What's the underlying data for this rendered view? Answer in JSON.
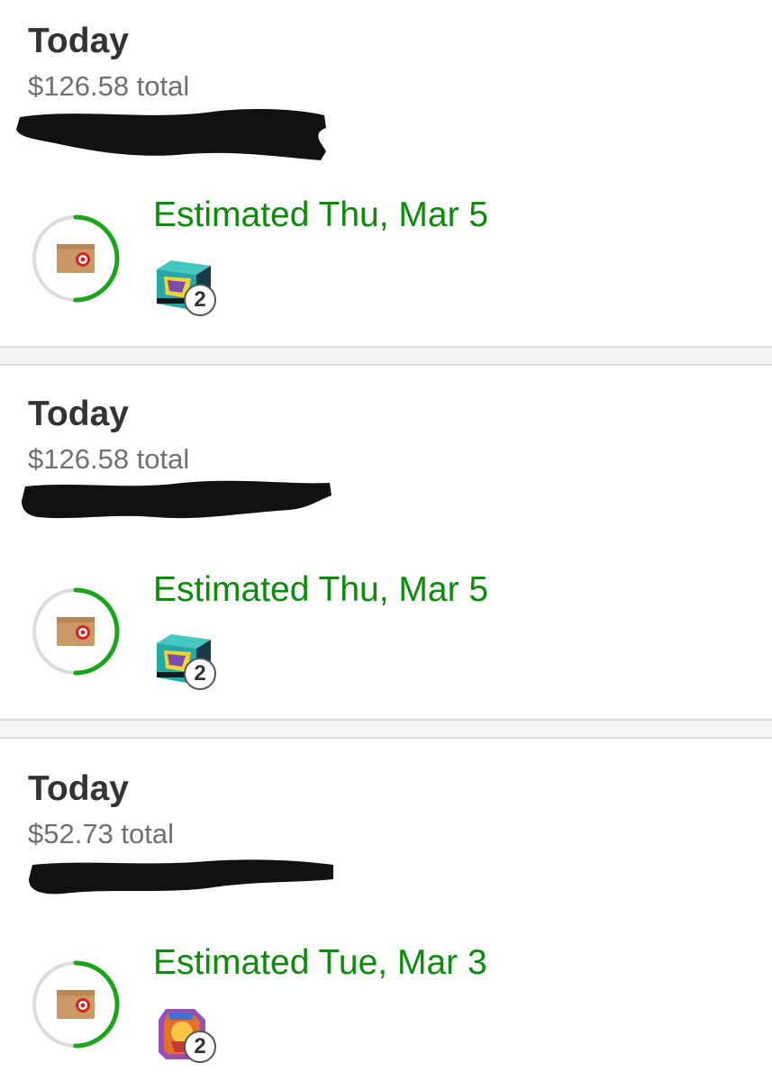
{
  "colors": {
    "eta_green": "#0b8a0b",
    "ring_green": "#1aa51a",
    "ring_track": "#dcdcdc",
    "title_text": "#333333",
    "total_text": "#707070",
    "divider_bg": "#f5f5f5",
    "redaction": "#111111"
  },
  "orders": [
    {
      "date_label": "Today",
      "total_text": "$126.58 total",
      "eta_text": "Estimated Thu, Mar 5",
      "item_quantity": "2",
      "delivery_progress": 0.5,
      "status_icon": "target-box-icon",
      "thumbnail": "trading-card-box-thumbnail"
    },
    {
      "date_label": "Today",
      "total_text": "$126.58 total",
      "eta_text": "Estimated Thu, Mar 5",
      "item_quantity": "2",
      "delivery_progress": 0.5,
      "status_icon": "target-box-icon",
      "thumbnail": "trading-card-box-thumbnail"
    },
    {
      "date_label": "Today",
      "total_text": "$52.73 total",
      "eta_text": "Estimated Tue, Mar 3",
      "item_quantity": "2",
      "delivery_progress": 0.5,
      "status_icon": "target-box-icon",
      "thumbnail": "trading-card-tin-thumbnail"
    }
  ]
}
